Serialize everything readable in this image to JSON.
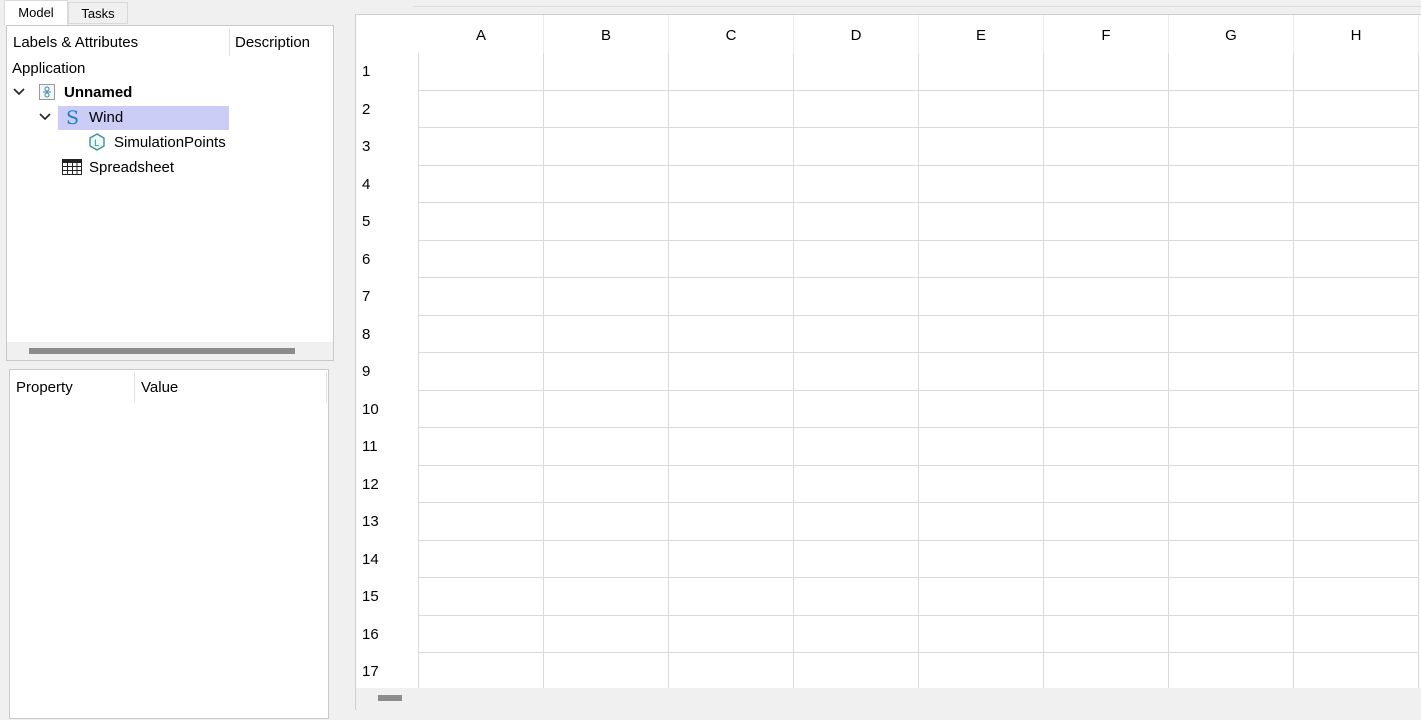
{
  "tabs": [
    {
      "label": "Model",
      "active": true
    },
    {
      "label": "Tasks",
      "active": false
    }
  ],
  "tree": {
    "columns": {
      "labels": "Labels & Attributes",
      "description": "Description"
    },
    "root_label": "Application",
    "items": [
      {
        "label": "Unnamed",
        "icon": "document-icon",
        "expanded": true
      },
      {
        "label": "Wind",
        "icon": "wind-s-icon",
        "expanded": true,
        "selected": true
      },
      {
        "label": "SimulationPoints",
        "icon": "hexagon-l-icon"
      },
      {
        "label": "Spreadsheet",
        "icon": "spreadsheet-icon"
      }
    ]
  },
  "properties": {
    "columns": {
      "property": "Property",
      "value": "Value"
    }
  },
  "spreadsheet": {
    "columns": [
      "A",
      "B",
      "C",
      "D",
      "E",
      "F",
      "G",
      "H"
    ],
    "rows": [
      "1",
      "2",
      "3",
      "4",
      "5",
      "6",
      "7",
      "8",
      "9",
      "10",
      "11",
      "12",
      "13",
      "14",
      "15",
      "16",
      "17"
    ]
  },
  "colors": {
    "selection": "#cccdf6",
    "grid": "#dadada",
    "background": "#f0f0f0"
  }
}
